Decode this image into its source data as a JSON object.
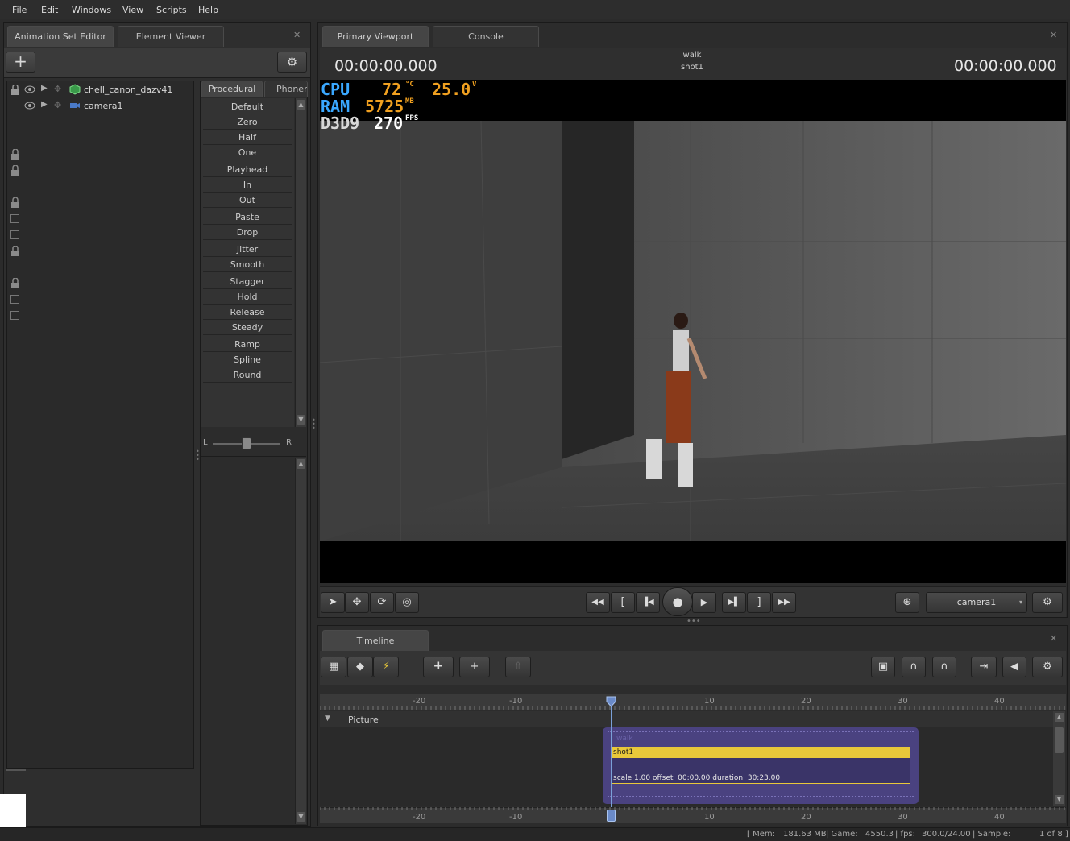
{
  "menu": [
    "File",
    "Edit",
    "Windows",
    "View",
    "Scripts",
    "Help"
  ],
  "left_tabs": {
    "animation_set_editor": "Animation Set Editor",
    "element_viewer": "Element Viewer"
  },
  "tree": {
    "items": [
      {
        "label": "chell_canon_dazv41",
        "icon": "cube-icon"
      },
      {
        "label": "camera1",
        "icon": "camera-icon"
      }
    ]
  },
  "proc_tabs": {
    "procedural": "Procedural",
    "phoneme": "Phoneme"
  },
  "procedural_items": [
    "Default",
    "Zero",
    "Half",
    "One",
    "Playhead",
    "In",
    "Out",
    "Paste",
    "Drop",
    "Jitter",
    "Smooth",
    "Stagger",
    "Hold",
    "Release",
    "Steady",
    "Ramp",
    "Spline",
    "Round"
  ],
  "balance": {
    "left": "L",
    "right": "R"
  },
  "viewport": {
    "tab_primary": "Primary Viewport",
    "tab_console": "Console",
    "timecode_left": "00:00:00.000",
    "timecode_right": "00:00:00.000",
    "anim_name": "walk",
    "shot_name": "shot1",
    "hud": {
      "cpu_label": "CPU",
      "cpu_temp": "72",
      "cpu_temp_unit": "°C",
      "cpu_volt": "25.0",
      "cpu_volt_unit": "V",
      "ram_label": "RAM",
      "ram_value": "5725",
      "ram_unit": "MB",
      "d3d_label": "D3D9",
      "fps_value": "270",
      "fps_unit": "FPS"
    },
    "camera_select": "camera1"
  },
  "timeline": {
    "tab": "Timeline",
    "track_name": "Picture",
    "clip_label": "walk",
    "shot_label": "shot1",
    "shot_info": "scale 1.00 offset  00:00.00 duration  30:23.00",
    "ruler_ticks": [
      "-20",
      "-10",
      "10",
      "20",
      "30",
      "40"
    ]
  },
  "status": {
    "mem_label": "[ Mem:",
    "mem_value": "181.63 MB",
    "game_label": "| Game:",
    "game_value": "4550.3",
    "fps_label": "| fps:",
    "fps_value": "300.0/24.00",
    "sample_label": "| Sample:",
    "sample_value": "1 of 8 ]"
  },
  "colors": {
    "accent_yellow": "#e8c83a",
    "hud_blue": "#3aa8ff",
    "hud_orange": "#f0a020",
    "clip_purple": "#4a4280"
  }
}
